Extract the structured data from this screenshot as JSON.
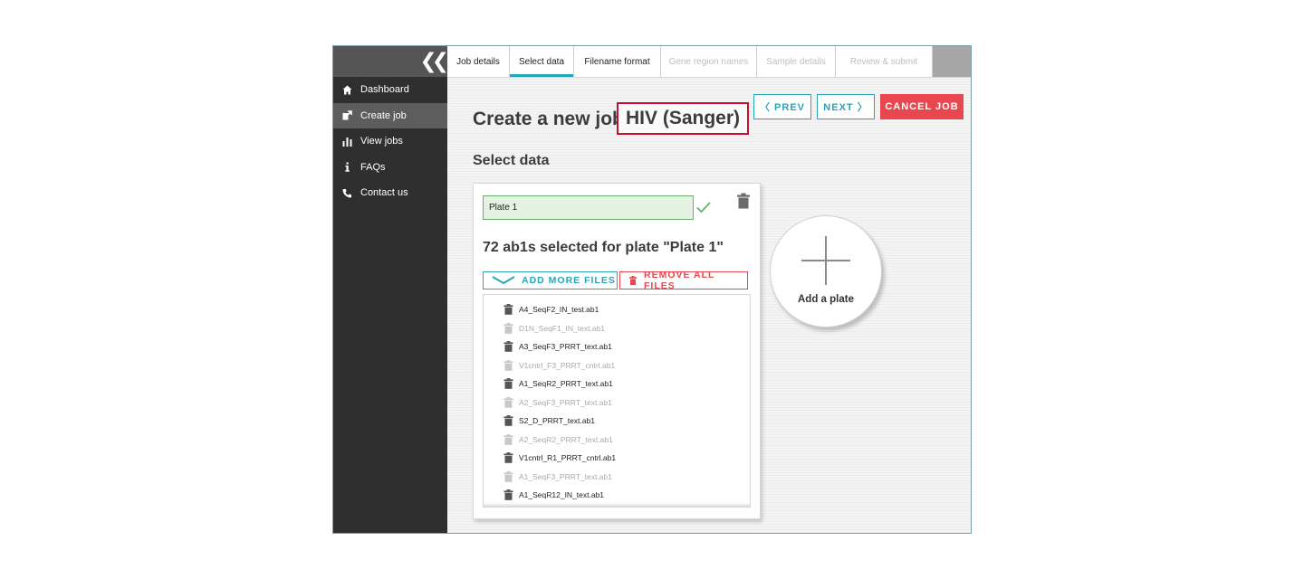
{
  "sidebar": {
    "collapse_icon": "double-chevron-left-icon",
    "items": [
      {
        "label": "Dashboard",
        "icon": "home-icon",
        "active": false
      },
      {
        "label": "Create job",
        "icon": "create-job-icon",
        "active": true
      },
      {
        "label": "View jobs",
        "icon": "bar-chart-icon",
        "active": false
      },
      {
        "label": "FAQs",
        "icon": "info-icon",
        "active": false
      },
      {
        "label": "Contact us",
        "icon": "phone-icon",
        "active": false
      }
    ]
  },
  "tabs": [
    {
      "label": "Job details",
      "state": "enabled"
    },
    {
      "label": "Select data",
      "state": "active"
    },
    {
      "label": "Filename format",
      "state": "enabled"
    },
    {
      "label": "Gene region names",
      "state": "disabled"
    },
    {
      "label": "Sample details",
      "state": "disabled"
    },
    {
      "label": "Review & submit",
      "state": "disabled"
    }
  ],
  "header": {
    "title": "Create a new job",
    "job_type": "HIV (Sanger)",
    "prev_label": "〈  PREV",
    "next_label": "NEXT  〉",
    "cancel_label": "CANCEL JOB"
  },
  "section_title": "Select data",
  "plate": {
    "name_value": "Plate 1",
    "selected_text": "72 ab1s selected for plate \"Plate 1\"",
    "add_files_label": "ADD MORE FILES",
    "remove_files_label": "REMOVE ALL FILES",
    "files": [
      {
        "name": "A4_SeqF2_IN_test.ab1",
        "enabled": true
      },
      {
        "name": "D1N_SeqF1_IN_text.ab1",
        "enabled": false
      },
      {
        "name": "A3_SeqF3_PRRT_text.ab1",
        "enabled": true
      },
      {
        "name": "V1cntrl_F3_PRRT_cntrl.ab1",
        "enabled": false
      },
      {
        "name": "A1_SeqR2_PRRT_text.ab1",
        "enabled": true
      },
      {
        "name": "A2_SeqF3_PRRT_text.ab1",
        "enabled": false
      },
      {
        "name": "S2_D_PRRT_text.ab1",
        "enabled": true
      },
      {
        "name": "A2_SeqR2_PRRT_text.ab1",
        "enabled": false
      },
      {
        "name": "V1cntrl_R1_PRRT_cntrl.ab1",
        "enabled": true
      },
      {
        "name": "A1_SeqF3_PRRT_text.ab1",
        "enabled": false
      },
      {
        "name": "A1_SeqR12_IN_text.ab1",
        "enabled": true
      }
    ]
  },
  "add_plate_label": "Add a plate",
  "colors": {
    "accent": "#27a5b9",
    "danger": "#e8474f",
    "job_type_border": "#c8102e",
    "valid_green": "#6bb06a"
  }
}
